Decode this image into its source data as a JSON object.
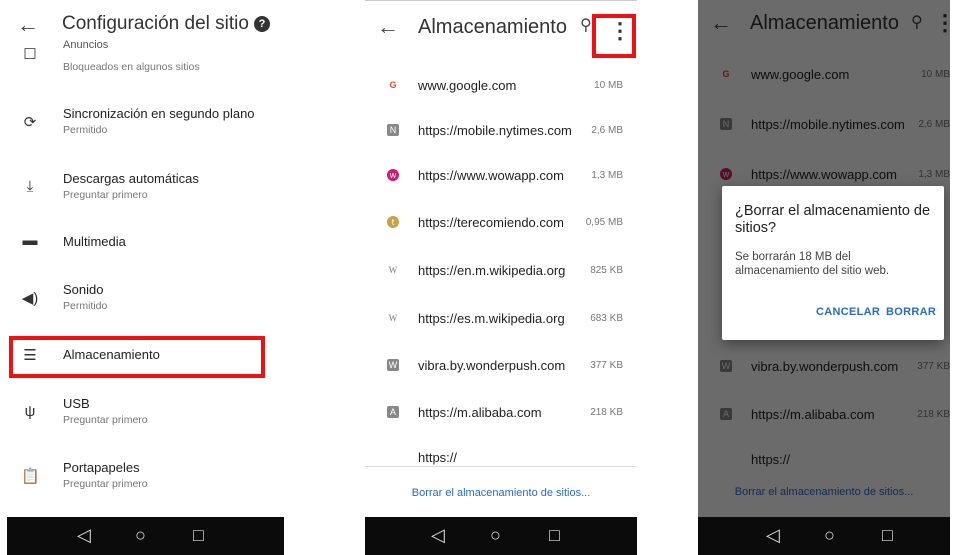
{
  "settings": {
    "title": "Configuración del sitio",
    "help_icon": "help-icon",
    "partial_item": {
      "title": "Anuncios",
      "subtitle": "Bloqueados en algunos sitios"
    },
    "items": [
      {
        "title": "Sincronización en segundo plano",
        "subtitle": "Permitido",
        "icon": "sync-icon"
      },
      {
        "title": "Descargas automáticas",
        "subtitle": "Preguntar primero",
        "icon": "download-icon"
      },
      {
        "title": "Multimedia",
        "subtitle": "",
        "icon": "media-icon"
      },
      {
        "title": "Sonido",
        "subtitle": "Permitido",
        "icon": "sound-icon"
      },
      {
        "title": "Almacenamiento",
        "subtitle": "",
        "icon": "storage-icon"
      },
      {
        "title": "USB",
        "subtitle": "Preguntar primero",
        "icon": "usb-icon"
      },
      {
        "title": "Portapapeles",
        "subtitle": "Preguntar primero",
        "icon": "clipboard-icon"
      }
    ]
  },
  "storage": {
    "title": "Almacenamiento",
    "sites": [
      {
        "url": "www.google.com",
        "size": "10 MB",
        "fav": "G"
      },
      {
        "url": "https://mobile.nytimes.com",
        "size": "2,6 MB",
        "fav": "N"
      },
      {
        "url": "https://www.wowapp.com",
        "size": "1,3 MB",
        "fav": "w"
      },
      {
        "url": "https://terecomiendo.com",
        "size": "0,95 MB",
        "fav": "t"
      },
      {
        "url": "https://en.m.wikipedia.org",
        "size": "825 KB",
        "fav": "W"
      },
      {
        "url": "https://es.m.wikipedia.org",
        "size": "683 KB",
        "fav": "W"
      },
      {
        "url": "vibra.by.wonderpush.com",
        "size": "377 KB",
        "fav": "W"
      },
      {
        "url": "https://m.alibaba.com",
        "size": "218 KB",
        "fav": "A"
      },
      {
        "url": "https://",
        "size": "",
        "fav": ""
      }
    ],
    "clear_link": "Borrar el almacenamiento de sitios..."
  },
  "dialog": {
    "title": "¿Borrar el almacenamiento de sitios?",
    "message": "Se borrarán 18 MB del almacenamiento del sitio web.",
    "cancel": "CANCELAR",
    "confirm": "BORRAR"
  },
  "nav": {
    "back": "◁",
    "home": "○",
    "recents": "□"
  },
  "colors": {
    "highlight": "#e11111",
    "link": "#2a6bc4"
  }
}
